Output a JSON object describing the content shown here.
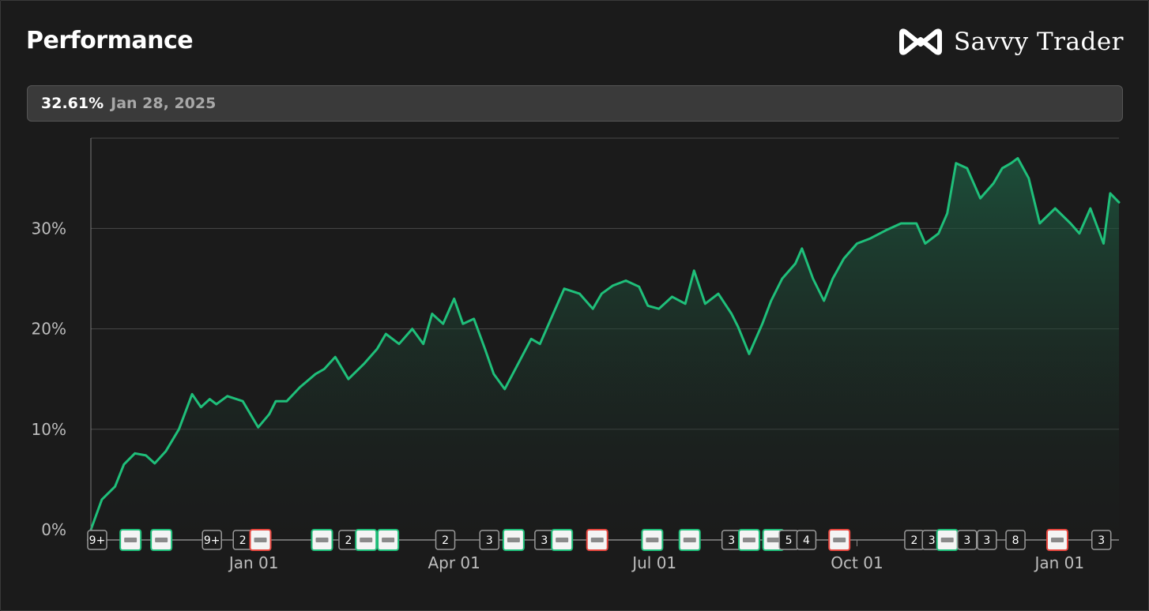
{
  "header": {
    "title": "Performance",
    "brand_name": "Savvy Trader",
    "brand_icon": "savvy-trader-logo-icon"
  },
  "tooltip": {
    "value": "32.61%",
    "date": "Jan 28, 2025"
  },
  "colors": {
    "line": "#1fbf7a",
    "fill_top": "#1d5e43",
    "background": "#1b1b1b",
    "grid": "#4a4a4a",
    "buy_border": "#1fbf7a",
    "sell_border": "#e8473f",
    "count_border": "#9a9a9a"
  },
  "chart_data": {
    "type": "area",
    "title": "Performance",
    "xlabel": "",
    "ylabel": "",
    "x_range": [
      "2023-10-19",
      "2025-01-28"
    ],
    "ylim": [
      0,
      40
    ],
    "y_ticks": [
      0,
      10,
      20,
      30
    ],
    "y_tick_labels": [
      "0%",
      "10%",
      "20%",
      "30%"
    ],
    "x_ticks": [
      "2024-01-01",
      "2024-04-01",
      "2024-07-01",
      "2024-10-01",
      "2025-01-01"
    ],
    "x_tick_labels": [
      "Jan 01",
      "Apr 01",
      "Jul 01",
      "Oct 01",
      "Jan 01"
    ],
    "grid": true,
    "series": [
      {
        "x": [
          "2023-10-19",
          "2023-10-24",
          "2023-10-30",
          "2023-11-03",
          "2023-11-08",
          "2023-11-13",
          "2023-11-17",
          "2023-11-22",
          "2023-11-28",
          "2023-12-04",
          "2023-12-08",
          "2023-12-12",
          "2023-12-15",
          "2023-12-20",
          "2023-12-27",
          "2024-01-03",
          "2024-01-08",
          "2024-01-11",
          "2024-01-16",
          "2024-01-22",
          "2024-01-29",
          "2024-02-02",
          "2024-02-07",
          "2024-02-13",
          "2024-02-20",
          "2024-02-26",
          "2024-03-01",
          "2024-03-07",
          "2024-03-13",
          "2024-03-18",
          "2024-03-22",
          "2024-03-27",
          "2024-04-01",
          "2024-04-05",
          "2024-04-10",
          "2024-04-15",
          "2024-04-19",
          "2024-04-24",
          "2024-04-30",
          "2024-05-06",
          "2024-05-10",
          "2024-05-15",
          "2024-05-21",
          "2024-05-28",
          "2024-06-03",
          "2024-06-07",
          "2024-06-12",
          "2024-06-18",
          "2024-06-24",
          "2024-06-28",
          "2024-07-03",
          "2024-07-09",
          "2024-07-15",
          "2024-07-19",
          "2024-07-24",
          "2024-07-30",
          "2024-08-05",
          "2024-08-08",
          "2024-08-13",
          "2024-08-19",
          "2024-08-23",
          "2024-08-28",
          "2024-09-03",
          "2024-09-06",
          "2024-09-11",
          "2024-09-16",
          "2024-09-20",
          "2024-09-25",
          "2024-10-01",
          "2024-10-07",
          "2024-10-14",
          "2024-10-21",
          "2024-10-28",
          "2024-11-01",
          "2024-11-07",
          "2024-11-11",
          "2024-11-15",
          "2024-11-20",
          "2024-11-26",
          "2024-12-02",
          "2024-12-06",
          "2024-12-10",
          "2024-12-13",
          "2024-12-18",
          "2024-12-23",
          "2024-12-30",
          "2025-01-06",
          "2025-01-10",
          "2025-01-15",
          "2025-01-21",
          "2025-01-24",
          "2025-01-28"
        ],
        "y": [
          0.0,
          3.0,
          4.3,
          6.5,
          7.6,
          7.4,
          6.6,
          7.8,
          10.0,
          13.5,
          12.2,
          13.0,
          12.5,
          13.3,
          12.8,
          10.2,
          11.5,
          12.8,
          12.8,
          14.2,
          15.5,
          16.0,
          17.2,
          15.0,
          16.5,
          18.0,
          19.5,
          18.5,
          20.0,
          18.5,
          21.5,
          20.5,
          23.0,
          20.5,
          21.0,
          18.0,
          15.5,
          14.0,
          16.5,
          19.0,
          18.5,
          21.0,
          24.0,
          23.5,
          22.0,
          23.5,
          24.3,
          24.8,
          24.2,
          22.3,
          22.0,
          23.2,
          22.5,
          25.8,
          22.5,
          23.5,
          21.5,
          20.2,
          17.5,
          20.5,
          22.8,
          25.0,
          26.5,
          28.0,
          25.0,
          22.8,
          25.0,
          27.0,
          28.5,
          29.0,
          29.8,
          30.5,
          30.5,
          28.5,
          29.5,
          31.5,
          36.5,
          36.0,
          33.0,
          34.5,
          36.0,
          36.5,
          37.0,
          35.0,
          30.5,
          32.0,
          30.5,
          29.5,
          32.0,
          28.5,
          33.5,
          32.6
        ]
      }
    ],
    "trade_markers": [
      {
        "date": "2023-10-19",
        "label": "9+",
        "kind": "count"
      },
      {
        "date": "2023-11-06",
        "label": "",
        "icon": "ametek-logo-icon",
        "kind": "buy"
      },
      {
        "date": "2023-11-20",
        "label": "",
        "icon": "mcdonalds-logo-icon",
        "kind": "buy"
      },
      {
        "date": "2023-12-13",
        "label": "9+",
        "kind": "count"
      },
      {
        "date": "2023-12-27",
        "label": "2",
        "kind": "count"
      },
      {
        "date": "2024-01-04",
        "label": "",
        "icon": "nike-logo-icon",
        "kind": "sell"
      },
      {
        "date": "2024-02-01",
        "label": "",
        "icon": "resmed-logo-icon",
        "kind": "buy"
      },
      {
        "date": "2024-02-13",
        "label": "2",
        "kind": "count"
      },
      {
        "date": "2024-02-21",
        "label": "",
        "icon": "company-logo-icon",
        "kind": "buy"
      },
      {
        "date": "2024-03-02",
        "label": "",
        "icon": "monster-logo-icon",
        "kind": "buy"
      },
      {
        "date": "2024-03-28",
        "label": "2",
        "kind": "count"
      },
      {
        "date": "2024-04-17",
        "label": "3",
        "kind": "count"
      },
      {
        "date": "2024-04-28",
        "label": "",
        "icon": "zoetis-chart-logo-icon",
        "kind": "buy"
      },
      {
        "date": "2024-05-12",
        "label": "3",
        "kind": "count"
      },
      {
        "date": "2024-05-20",
        "label": "",
        "icon": "adp-logo-icon",
        "kind": "buy"
      },
      {
        "date": "2024-06-05",
        "label": "",
        "icon": "monster-logo-icon",
        "kind": "sell"
      },
      {
        "date": "2024-06-30",
        "label": "",
        "icon": "stericycle-logo-icon",
        "kind": "buy"
      },
      {
        "date": "2024-07-17",
        "label": "",
        "icon": "adobe-logo-icon",
        "kind": "buy"
      },
      {
        "date": "2024-08-05",
        "label": "3",
        "kind": "count"
      },
      {
        "date": "2024-08-13",
        "label": "",
        "icon": "zoetis-logo-icon",
        "kind": "buy"
      },
      {
        "date": "2024-08-24",
        "label": "",
        "icon": "weather-logo-icon",
        "kind": "buy"
      },
      {
        "date": "2024-08-31",
        "label": "5",
        "kind": "count"
      },
      {
        "date": "2024-09-08",
        "label": "4",
        "kind": "count"
      },
      {
        "date": "2024-09-23",
        "label": "",
        "icon": "building-logo-icon",
        "kind": "sell"
      },
      {
        "date": "2024-10-27",
        "label": "2",
        "kind": "count"
      },
      {
        "date": "2024-11-04",
        "label": "3",
        "kind": "count"
      },
      {
        "date": "2024-11-11",
        "label": "",
        "icon": "monster-logo-icon",
        "kind": "buy"
      },
      {
        "date": "2024-11-20",
        "label": "3",
        "kind": "count"
      },
      {
        "date": "2024-11-29",
        "label": "3",
        "kind": "count"
      },
      {
        "date": "2024-12-12",
        "label": "8",
        "kind": "count"
      },
      {
        "date": "2024-12-31",
        "label": "",
        "icon": "mountain-logo-icon",
        "kind": "sell"
      },
      {
        "date": "2025-01-20",
        "label": "3",
        "kind": "count"
      }
    ]
  }
}
